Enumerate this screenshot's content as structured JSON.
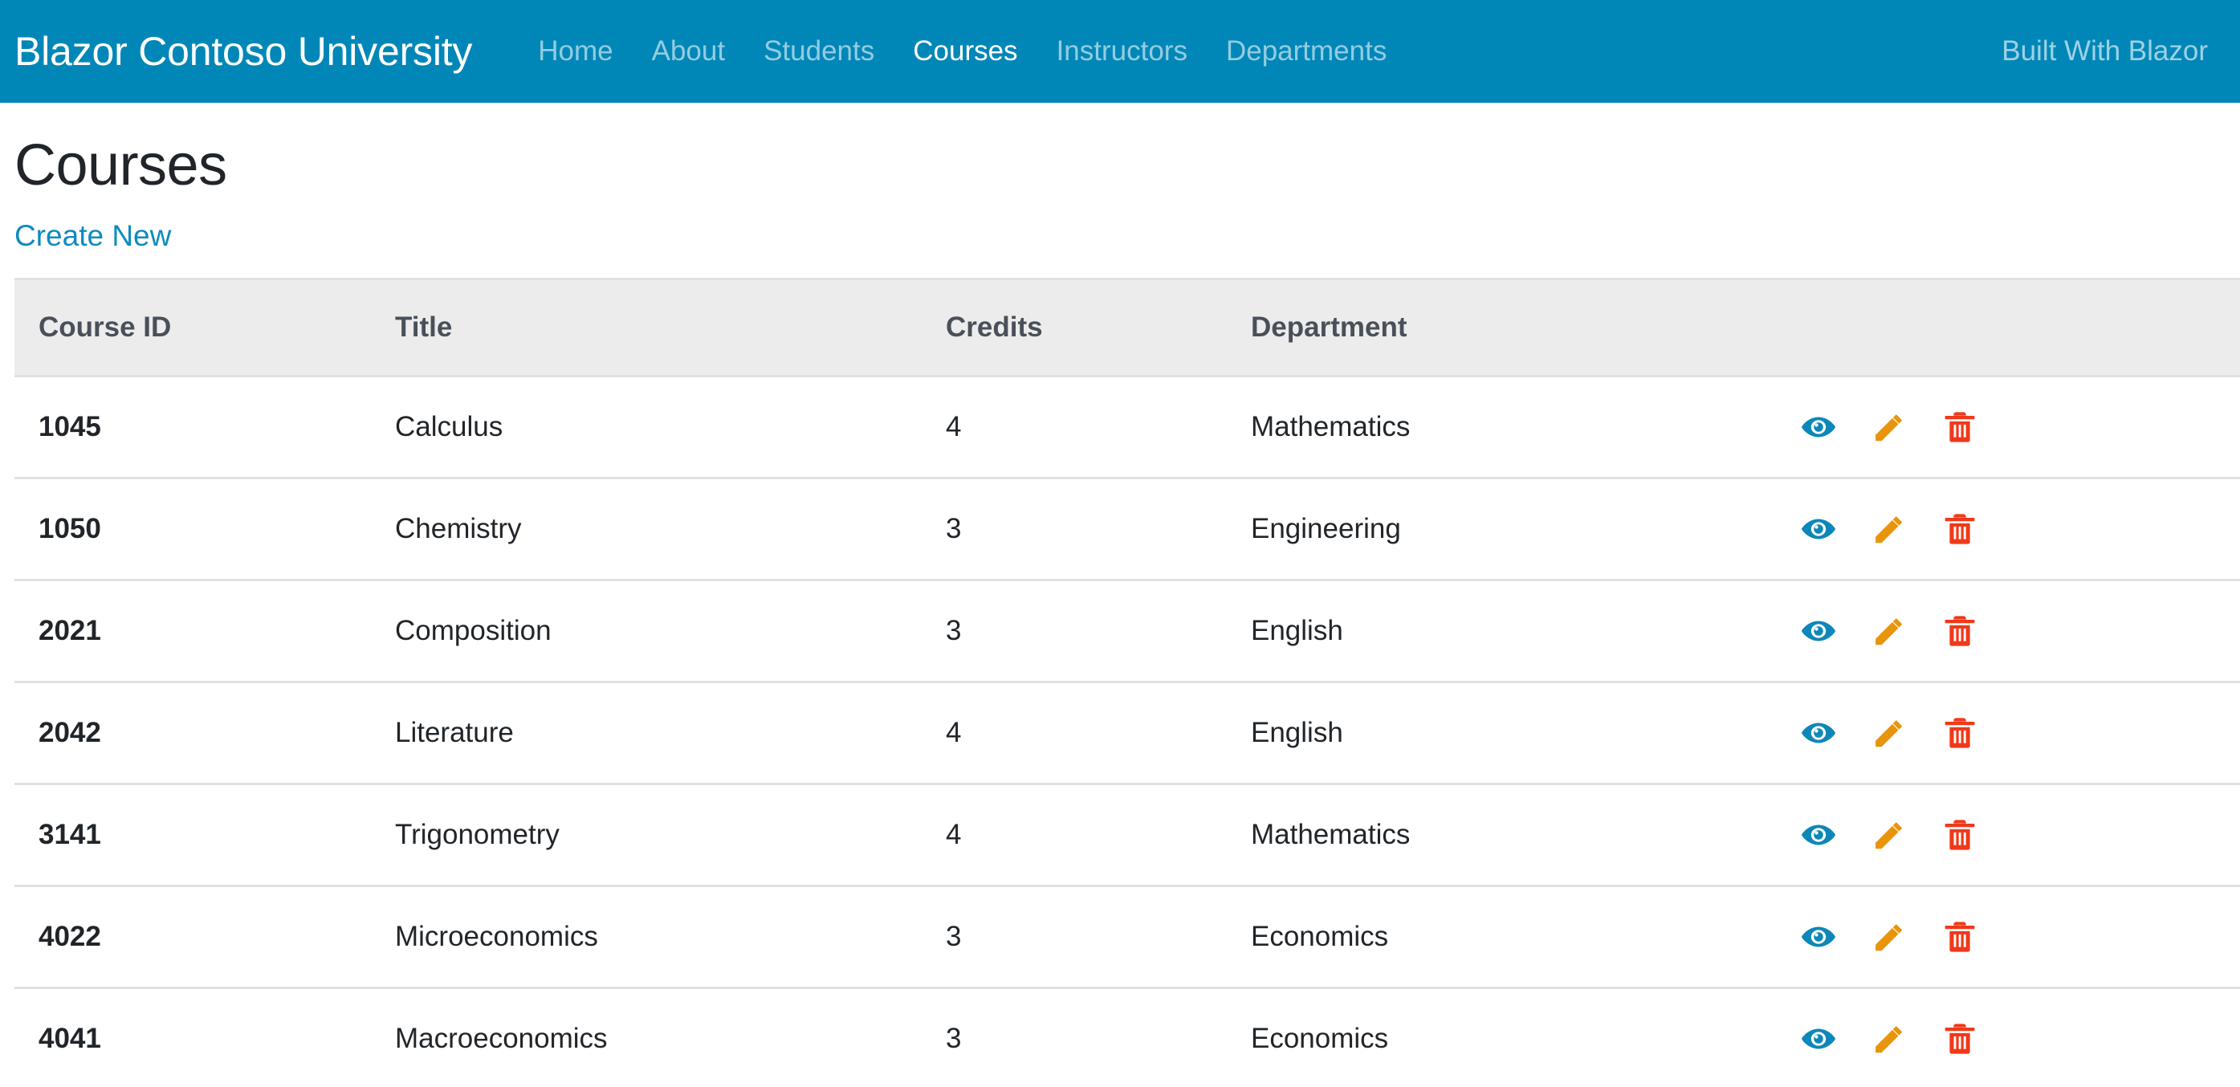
{
  "navbar": {
    "brand": "Blazor Contoso University",
    "links": [
      {
        "label": "Home",
        "active": false
      },
      {
        "label": "About",
        "active": false
      },
      {
        "label": "Students",
        "active": false
      },
      {
        "label": "Courses",
        "active": true
      },
      {
        "label": "Instructors",
        "active": false
      },
      {
        "label": "Departments",
        "active": false
      }
    ],
    "right_text": "Built With Blazor",
    "background_color": "#0087b8",
    "active_link_color": "#ffffff",
    "inactive_link_color": "rgba(255,255,255,0.58)"
  },
  "page": {
    "title": "Courses",
    "create_new_label": "Create New",
    "link_color": "#0d8bbf"
  },
  "table": {
    "header_background": "#ececec",
    "border_color": "#dee2e6",
    "columns": [
      "Course ID",
      "Title",
      "Credits",
      "Department",
      ""
    ],
    "rows": [
      {
        "course_id": "1045",
        "title": "Calculus",
        "credits": "4",
        "department": "Mathematics"
      },
      {
        "course_id": "1050",
        "title": "Chemistry",
        "credits": "3",
        "department": "Engineering"
      },
      {
        "course_id": "2021",
        "title": "Composition",
        "credits": "3",
        "department": "English"
      },
      {
        "course_id": "2042",
        "title": "Literature",
        "credits": "4",
        "department": "English"
      },
      {
        "course_id": "3141",
        "title": "Trigonometry",
        "credits": "4",
        "department": "Mathematics"
      },
      {
        "course_id": "4022",
        "title": "Microeconomics",
        "credits": "3",
        "department": "Economics"
      },
      {
        "course_id": "4041",
        "title": "Macroeconomics",
        "credits": "3",
        "department": "Economics"
      }
    ],
    "actions": {
      "view": {
        "icon": "eye-icon",
        "label": "View",
        "color": "#0d87b8"
      },
      "edit": {
        "icon": "pencil-icon",
        "label": "Edit",
        "color": "#e8940c"
      },
      "delete": {
        "icon": "trash-icon",
        "label": "Delete",
        "color": "#f0391a"
      }
    }
  }
}
